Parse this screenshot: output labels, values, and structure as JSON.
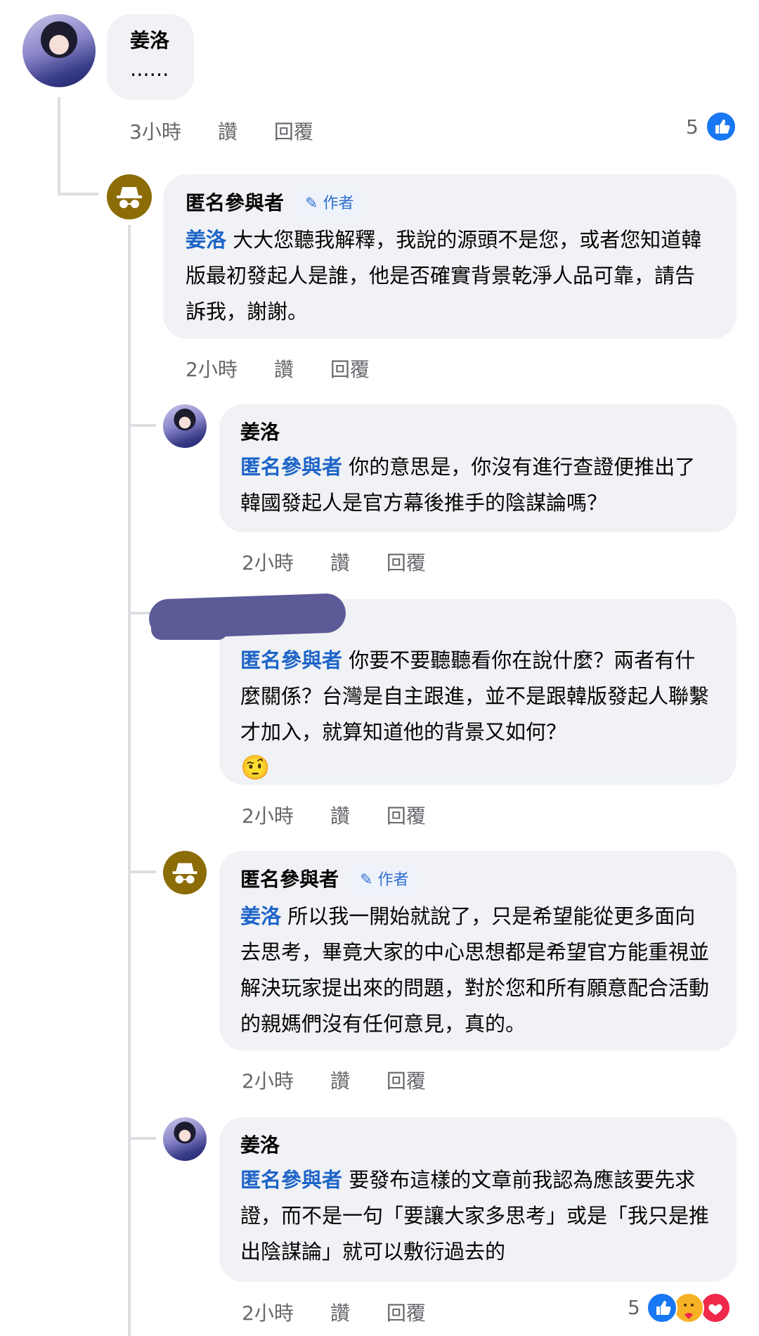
{
  "comments": [
    {
      "author": "姜洛",
      "text": "......",
      "time": "3小時",
      "like": "讚",
      "reply": "回覆",
      "reactions": "5"
    },
    {
      "author": "匿名參與者",
      "badge": "作者",
      "mention": "姜洛",
      "text": " 大大您聽我解釋，我說的源頭不是您，或者您知道韓版最初發起人是誰，他是否確實背景乾淨人品可靠，請告訴我，謝謝。",
      "time": "2小時",
      "like": "讚",
      "reply": "回覆"
    },
    {
      "author": "姜洛",
      "mention": "匿名參與者",
      "text": " 你的意思是，你沒有進行查證便推出了韓國發起人是官方幕後推手的陰謀論嗎？",
      "time": "2小時",
      "like": "讚",
      "reply": "回覆"
    },
    {
      "author": "",
      "mention": "匿名參與者",
      "text": " 你要不要聽聽看你在說什麼？兩者有什麼關係？台灣是自主跟進，並不是跟韓版發起人聯繫才加入，就算知道他的背景又如何？",
      "emoji": "🤨",
      "time": "2小時",
      "like": "讚",
      "reply": "回覆"
    },
    {
      "author": "匿名參與者",
      "badge": "作者",
      "mention": "姜洛",
      "text": " 所以我一開始就說了，只是希望能從更多面向去思考，畢竟大家的中心思想都是希望官方能重視並解決玩家提出來的問題，對於您和所有願意配合活動的親媽們沒有任何意見，真的。",
      "time": "2小時",
      "like": "讚",
      "reply": "回覆"
    },
    {
      "author": "姜洛",
      "mention": "匿名參與者",
      "text": " 要發布這樣的文章前我認為應該要先求證，而不是一句「要讓大家多思考」或是「我只是推出陰謀論」就可以敷衍過去的",
      "time": "2小時",
      "like": "讚",
      "reply": "回覆",
      "reactions": "5"
    }
  ],
  "colors": {
    "mention": "#1d64c8",
    "bubble": "#f0f2f5",
    "meta": "#65676b",
    "like_blue": "#1877f2"
  },
  "icons": [
    "avatar",
    "anonymous-hat-icon",
    "pencil-icon",
    "like-reaction-icon",
    "care-reaction-icon",
    "love-reaction-icon"
  ]
}
